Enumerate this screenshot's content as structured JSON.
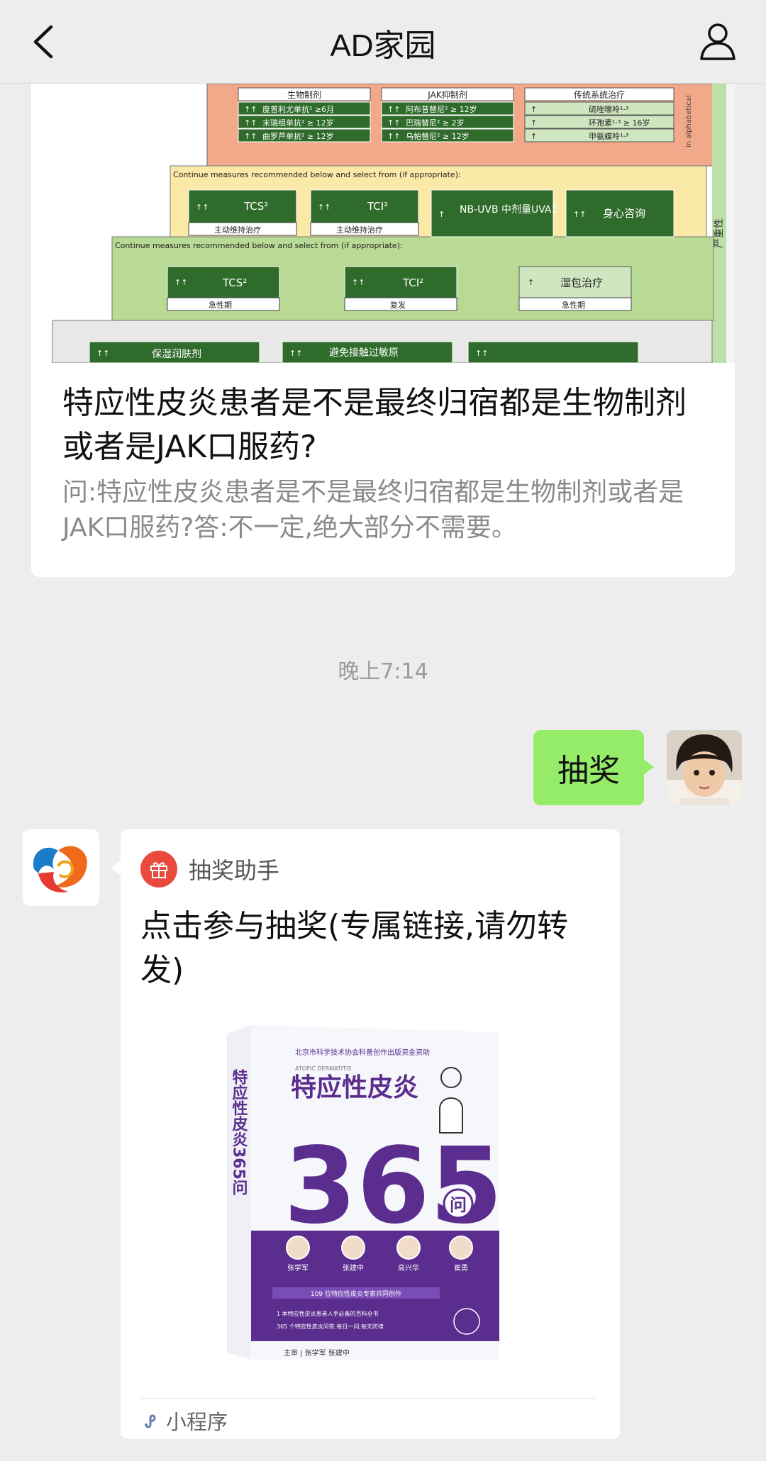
{
  "nav": {
    "title": "AD家园"
  },
  "article": {
    "cover": {
      "tier3_heads": [
        "生物制剂",
        "JAK抑制剂",
        "传统系统治疗"
      ],
      "tier3_rows": [
        [
          "度普利尤单抗² ≥6月",
          "阿布昔替尼² ≥ 12岁",
          "硫唑嘌呤¹·³"
        ],
        [
          "末瑞组单抗² ≥ 12岁",
          "巴瑞替尼² ≥ 2岁",
          "环孢素¹·³ ≥ 16岁"
        ],
        [
          "曲罗芦单抗² ≥ 12岁",
          "乌帕替尼² ≥ 12岁",
          "甲氨蝶呤¹·³"
        ]
      ],
      "side_label": "in alphabetical",
      "severity_label": "严重性",
      "continue_text": "Continue measures recommended below and select from (if appropriate):",
      "tier2": [
        {
          "arrows": "↑↑",
          "name": "TCS²",
          "sub": "主动维持治疗"
        },
        {
          "arrows": "↑↑",
          "name": "TCI²",
          "sub": "主动维持治疗"
        },
        {
          "arrows": "↑",
          "name": "NB-UVB 中剂量UVA1",
          "sub": ""
        },
        {
          "arrows": "↑↑",
          "name": "身心咨询",
          "sub": ""
        }
      ],
      "tier1": [
        {
          "arrows": "↑↑",
          "name": "TCS²",
          "sub": "急性期"
        },
        {
          "arrows": "↑↑",
          "name": "TCI²",
          "sub": "复发"
        },
        {
          "arrows": "↑",
          "name": "湿包治疗",
          "sub": "急性期"
        }
      ],
      "tier0": [
        {
          "arrows": "↑↑",
          "name": "保湿润肤剂"
        },
        {
          "arrows": "↑↑",
          "name": "避免接触过敏原"
        },
        {
          "arrows": "↑↑",
          "name": ""
        }
      ]
    },
    "headline": "特应性皮炎患者是不是最终归宿都是生物制剂或者是JAK口服药?",
    "digest": "问:特应性皮炎患者是不是最终归宿都是生物制剂或者是JAK口服药?答:不一定,绝大部分不需要。"
  },
  "timestamp": "晚上7:14",
  "outgoing": {
    "text": "抽奖"
  },
  "mini_program": {
    "app_name": "抽奖助手",
    "title": "点击参与抽奖(专属链接,请勿转发)",
    "footer_label": "小程序",
    "book": {
      "top_line": "北京市科学技术协会科普创作出版资金资助",
      "eng": "ATOPIC DERMATITIS",
      "title": "特应性皮炎",
      "big_number": "365",
      "wen": "问",
      "spine": "特应性皮炎365问",
      "authors": [
        "张学军",
        "张建中",
        "高兴华",
        "崔勇"
      ],
      "band": "109 位特应性皮炎专家共同创作",
      "bullet1": "1 本特应性皮炎患者人手必备的百科全书",
      "bullet2": "365 个特应性皮炎问答,每日一问,每天防律",
      "bottom": "主审 | 张学军 张建中"
    }
  },
  "colors": {
    "bg": "#ededed",
    "outgoing_bubble": "#95ec69",
    "book_purple": "#5b2d8e"
  }
}
